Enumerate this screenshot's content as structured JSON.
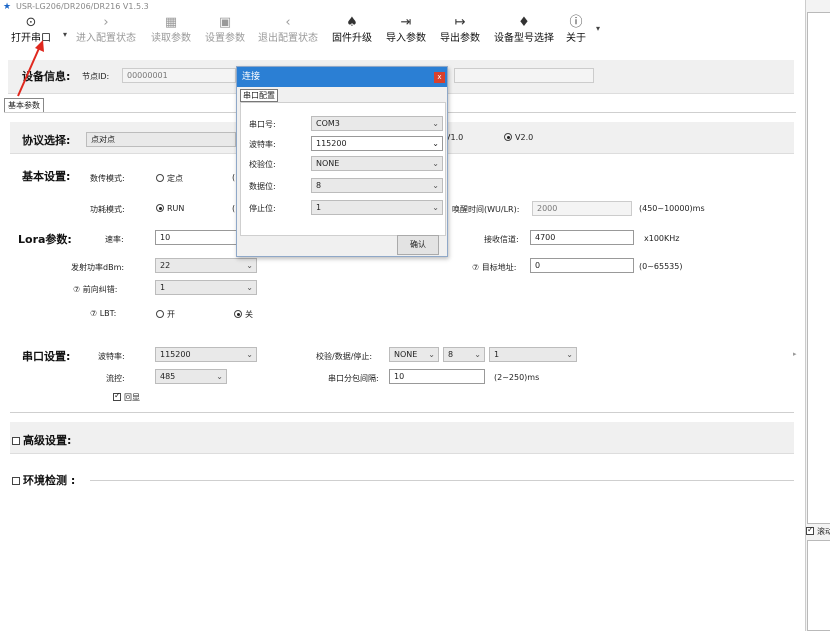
{
  "window": {
    "title": "USR-LG206/DR206/DR216 V1.5.3"
  },
  "toolbar": {
    "open_port": "打开串口",
    "enter_config": "进入配置状态",
    "read_params": "读取参数",
    "set_params": "设置参数",
    "exit_config": "退出配置状态",
    "firmware": "固件升级",
    "import": "导入参数",
    "export": "导出参数",
    "device_model": "设备型号选择",
    "about": "关于"
  },
  "device_info": {
    "label": "设备信息:",
    "node_id_label": "节点ID:",
    "node_id_value": "00000001"
  },
  "tab": {
    "basic": "基本参数"
  },
  "protocol": {
    "label": "协议选择:",
    "value": "点对点",
    "v1": "V1.0",
    "v2": "V2.0"
  },
  "basic": {
    "label": "基本设置:",
    "transfer_mode_label": "数传模式:",
    "fixed_point": "定点",
    "power_mode_label": "功耗模式:",
    "run": "RUN",
    "wake_time_label": "唤醒时间(WU/LR):",
    "wake_time_value": "2000",
    "wake_time_range": "(450~10000)ms"
  },
  "lora": {
    "label": "Lora参数:",
    "rate_label": "速率:",
    "rate_value": "10",
    "recv_channel_label": "接收信道:",
    "recv_channel_value": "4700",
    "recv_channel_unit": "x100KHz",
    "tx_power_label": "发射功率dBm:",
    "tx_power_value": "22",
    "target_addr_label": "目标地址:",
    "target_addr_value": "0",
    "target_addr_range": "(0~65535)",
    "fec_label": "前向纠错:",
    "fec_value": "1",
    "lbt_label": "LBT:",
    "lbt_on": "开",
    "lbt_off": "关"
  },
  "serial": {
    "label": "串口设置:",
    "baud_label": "波特率:",
    "baud_value": "115200",
    "parity_label": "校验/数据/停止:",
    "parity_value": "NONE",
    "data_value": "8",
    "stop_value": "1",
    "flow_label": "流控:",
    "flow_value": "485",
    "packet_label": "串口分包间隔:",
    "packet_value": "10",
    "packet_range": "(2~250)ms",
    "echo_label": "回显"
  },
  "advanced": {
    "label": "高级设置:"
  },
  "env": {
    "label": "环境检测 :"
  },
  "right": {
    "scroll_label": "滚动"
  },
  "dialog": {
    "title": "连接",
    "close": "x",
    "tab": "串口配置",
    "port_label": "串口号:",
    "port_value": "COM3",
    "baud_label": "波特率:",
    "baud_value": "115200",
    "parity_label": "校验位:",
    "parity_value": "NONE",
    "data_label": "数据位:",
    "data_value": "8",
    "stop_label": "停止位:",
    "stop_value": "1",
    "confirm": "确认"
  },
  "icons": {
    "app": "app-star-icon",
    "open_port": "check-circle-icon",
    "enter_config": "chevron-right-icon",
    "read_params": "grid-icon",
    "set_params": "save-icon",
    "exit_config": "chevron-left-icon",
    "firmware": "upload-icon",
    "import": "import-icon",
    "export": "export-icon",
    "device_model": "device-icon",
    "about": "info-icon"
  },
  "colors": {
    "dialog_title": "#2b7fd4",
    "close_button": "#d9402c",
    "annotation_arrow": "#e0281e"
  }
}
